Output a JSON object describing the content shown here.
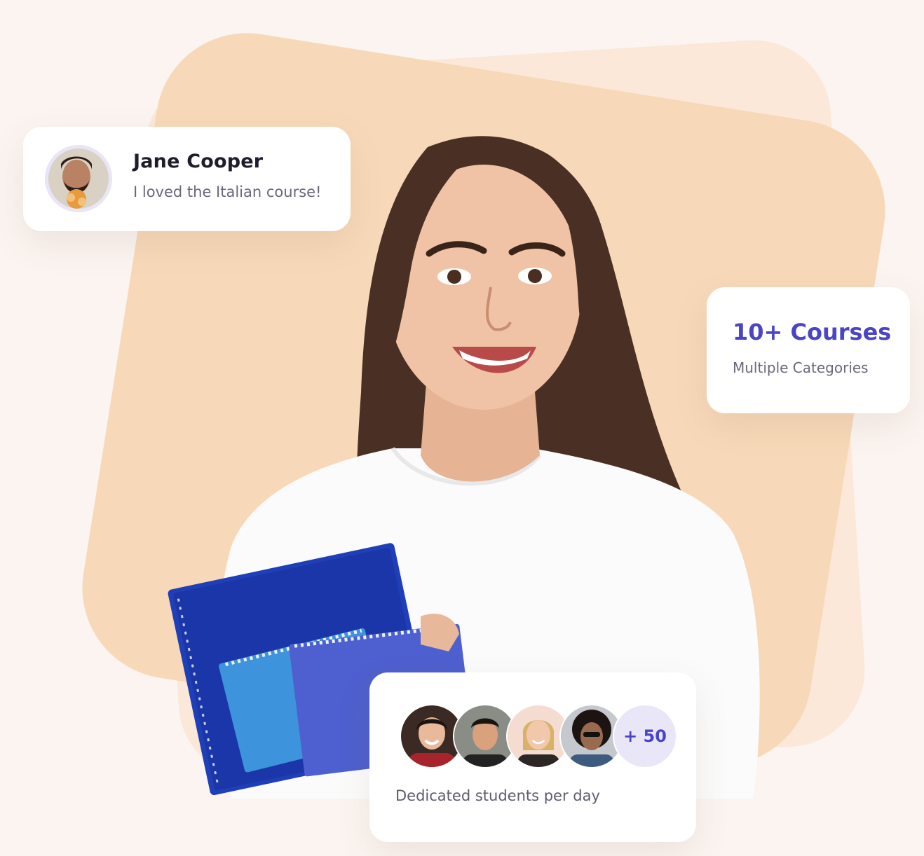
{
  "colors": {
    "page_background": "#fbf4f0",
    "blob_light": "#fbe8d8",
    "blob_peach": "#f7d9b9",
    "accent": "#4b45c6",
    "text_dark": "#1e1d2c",
    "text_muted": "#6b687a"
  },
  "hero": {
    "image": "smiling-student-holding-notebooks"
  },
  "review_card": {
    "avatar": "reviewer-avatar",
    "name": "Jane Cooper",
    "text": "I loved the Italian course!"
  },
  "courses_card": {
    "title": "10+ Courses",
    "subtitle": "Multiple Categories"
  },
  "students_card": {
    "avatars": [
      "student-avatar-1",
      "student-avatar-2",
      "student-avatar-3",
      "student-avatar-4"
    ],
    "more_count": "+ 50",
    "caption": "Dedicated students per day"
  }
}
